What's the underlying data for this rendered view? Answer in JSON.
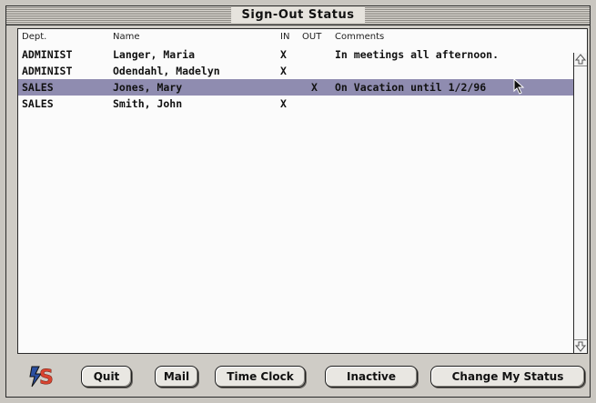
{
  "window": {
    "title": "Sign-Out Status"
  },
  "columns": {
    "dept": "Dept.",
    "name": "Name",
    "in": "IN",
    "out": "OUT",
    "comments": "Comments"
  },
  "rows": [
    {
      "dept": "ADMINIST",
      "name": "Langer, Maria",
      "in": "X",
      "out": "",
      "comments": "In meetings all afternoon.",
      "selected": false
    },
    {
      "dept": "ADMINIST",
      "name": "Odendahl, Madelyn",
      "in": "X",
      "out": "",
      "comments": "",
      "selected": false
    },
    {
      "dept": "SALES",
      "name": "Jones, Mary",
      "in": "",
      "out": "X",
      "comments": "On Vacation until 1/2/96",
      "selected": true
    },
    {
      "dept": "SALES",
      "name": "Smith, John",
      "in": "X",
      "out": "",
      "comments": "",
      "selected": false
    }
  ],
  "scrollbar": {
    "up_icon": "scroll-up-arrow",
    "down_icon": "scroll-down-arrow"
  },
  "buttons": {
    "quit": "Quit",
    "mail": "Mail",
    "time_clock": "Time Clock",
    "inactive": "Inactive",
    "change_status": "Change My Status"
  },
  "logo": {
    "icon": "app-logo-icon",
    "letter": "S"
  },
  "colors": {
    "selection": "#8f8cb0",
    "window": "#cfccc6",
    "logo_blue": "#2b4fa0",
    "logo_red": "#d9432f"
  }
}
